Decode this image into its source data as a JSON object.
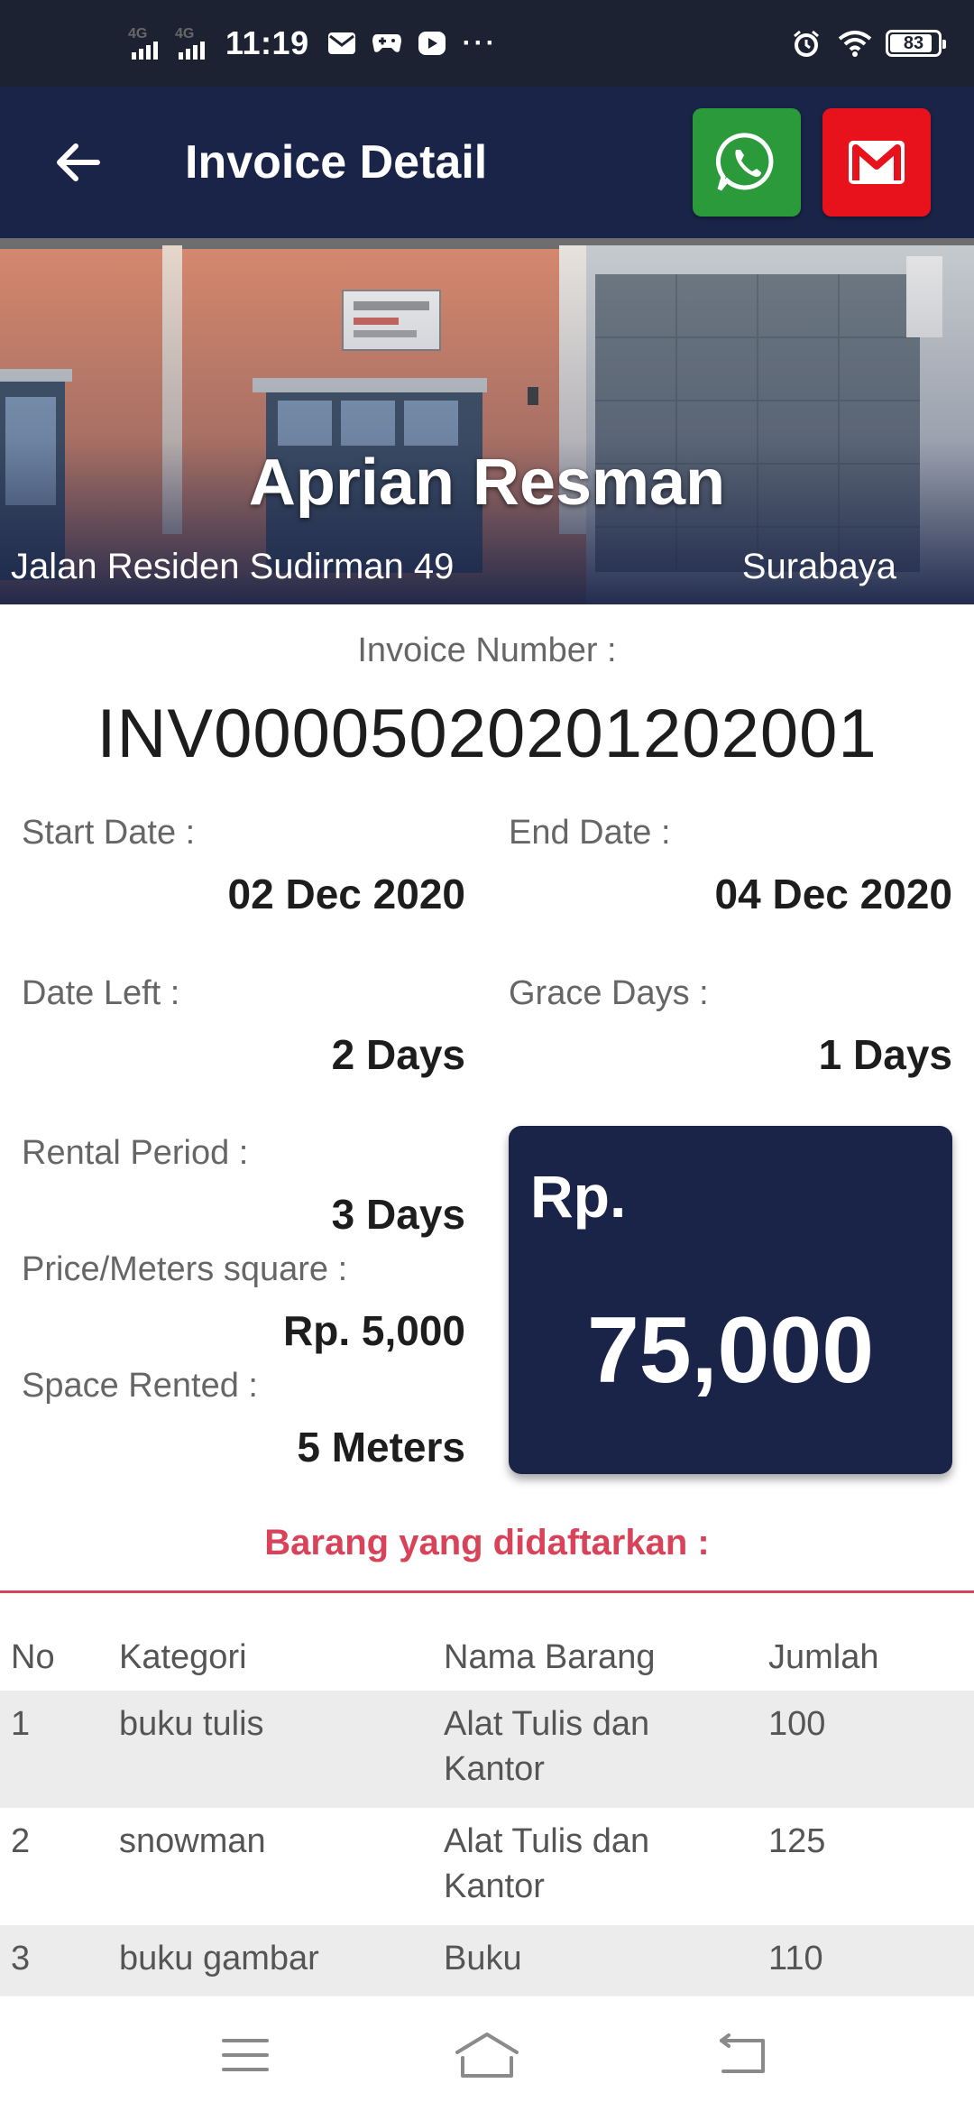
{
  "status_bar": {
    "network1": "4G",
    "network2": "4G",
    "time": "11:19",
    "dots": "···",
    "battery": "83"
  },
  "app_bar": {
    "title": "Invoice Detail",
    "whatsapp_icon": "whatsapp-icon",
    "mail_icon": "gmail-icon"
  },
  "customer": {
    "name": "Aprian Resman",
    "address": "Jalan Residen Sudirman 49",
    "city": "Surabaya"
  },
  "invoice": {
    "number_label": "Invoice Number :",
    "number": "INV00005020201202001",
    "start_label": "Start Date :",
    "start_value": "02 Dec 2020",
    "end_label": "End Date :",
    "end_value": "04 Dec 2020",
    "left_label": "Date Left :",
    "left_value": "2 Days",
    "grace_label": "Grace Days :",
    "grace_value": "1 Days",
    "period_label": "Rental Period :",
    "period_value": "3 Days",
    "price_label": "Price/Meters square :",
    "price_value": "Rp. 5,000",
    "space_label": "Space Rented :",
    "space_value": "5 Meters",
    "total_currency": "Rp.",
    "total_amount": "75,000"
  },
  "items": {
    "title": "Barang yang didaftarkan :",
    "headers": [
      "No",
      "Kategori",
      "Nama Barang",
      "Jumlah"
    ],
    "rows": [
      {
        "no": "1",
        "kategori": "buku tulis",
        "nama": "Alat Tulis dan Kantor",
        "jumlah": "100"
      },
      {
        "no": "2",
        "kategori": "snowman",
        "nama": "Alat Tulis dan Kantor",
        "jumlah": "125"
      },
      {
        "no": "3",
        "kategori": "buku gambar",
        "nama": "Buku",
        "jumlah": "110"
      }
    ]
  },
  "colors": {
    "app_bar": "#1a2448",
    "status_bar": "#1d2233",
    "whatsapp": "#2b9a3b",
    "mail": "#e8121d",
    "accent": "#d8435a"
  }
}
